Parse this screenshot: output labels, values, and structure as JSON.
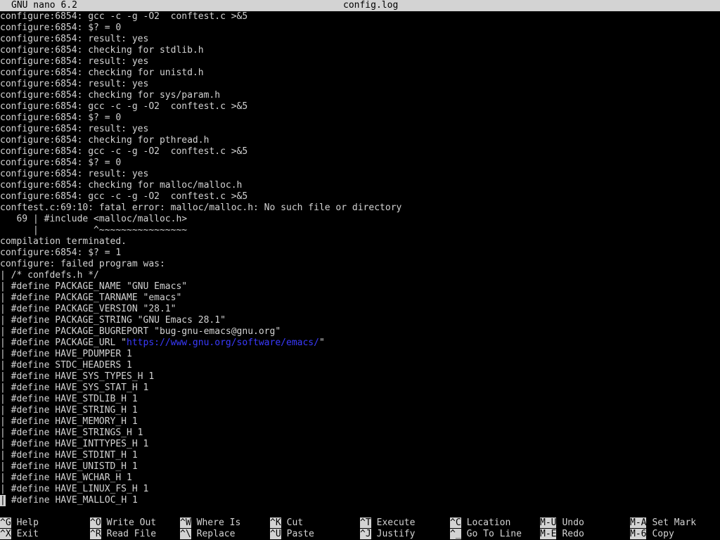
{
  "titlebar": {
    "app": "GNU nano 6.2",
    "filename": "config.log"
  },
  "editor": {
    "lines": [
      "configure:6854: gcc -c -g -O2  conftest.c >&5",
      "configure:6854: $? = 0",
      "configure:6854: result: yes",
      "configure:6854: checking for stdlib.h",
      "configure:6854: result: yes",
      "configure:6854: checking for unistd.h",
      "configure:6854: result: yes",
      "configure:6854: checking for sys/param.h",
      "configure:6854: gcc -c -g -O2  conftest.c >&5",
      "configure:6854: $? = 0",
      "configure:6854: result: yes",
      "configure:6854: checking for pthread.h",
      "configure:6854: gcc -c -g -O2  conftest.c >&5",
      "configure:6854: $? = 0",
      "configure:6854: result: yes",
      "configure:6854: checking for malloc/malloc.h",
      "configure:6854: gcc -c -g -O2  conftest.c >&5",
      "conftest.c:69:10: fatal error: malloc/malloc.h: No such file or directory",
      "   69 | #include <malloc/malloc.h>",
      "      |          ^~~~~~~~~~~~~~~~~",
      "compilation terminated.",
      "configure:6854: $? = 1",
      "configure: failed program was:",
      "| /* confdefs.h */",
      "| #define PACKAGE_NAME \"GNU Emacs\"",
      "| #define PACKAGE_TARNAME \"emacs\"",
      "| #define PACKAGE_VERSION \"28.1\"",
      "| #define PACKAGE_STRING \"GNU Emacs 28.1\"",
      "| #define PACKAGE_BUGREPORT \"bug-gnu-emacs@gnu.org\"",
      "| #define HAVE_PDUMPER 1",
      "| #define STDC_HEADERS 1",
      "| #define HAVE_SYS_TYPES_H 1",
      "| #define HAVE_SYS_STAT_H 1",
      "| #define HAVE_STDLIB_H 1",
      "| #define HAVE_STRING_H 1",
      "| #define HAVE_MEMORY_H 1",
      "| #define HAVE_STRINGS_H 1",
      "| #define HAVE_INTTYPES_H 1",
      "| #define HAVE_STDINT_H 1",
      "| #define HAVE_UNISTD_H 1",
      "| #define HAVE_WCHAR_H 1",
      "| #define HAVE_LINUX_FS_H 1",
      "| #define HAVE_MALLOC_H 1"
    ],
    "url_line": {
      "prefix": "| #define PACKAGE_URL \"",
      "url": "https://www.gnu.org/software/emacs/",
      "suffix": "\""
    },
    "last_line_rest": " #define HAVE_MALLOC_H 1",
    "cursor_char": "|"
  },
  "shortcuts": {
    "row0": [
      {
        "key": "^G",
        "label": "Help"
      },
      {
        "key": "^O",
        "label": "Write Out"
      },
      {
        "key": "^W",
        "label": "Where Is"
      },
      {
        "key": "^K",
        "label": "Cut"
      },
      {
        "key": "^T",
        "label": "Execute"
      },
      {
        "key": "^C",
        "label": "Location"
      },
      {
        "key": "M-U",
        "label": "Undo"
      },
      {
        "key": "M-A",
        "label": "Set Mark"
      }
    ],
    "row1": [
      {
        "key": "^X",
        "label": "Exit"
      },
      {
        "key": "^R",
        "label": "Read File"
      },
      {
        "key": "^\\",
        "label": "Replace"
      },
      {
        "key": "^U",
        "label": "Paste"
      },
      {
        "key": "^J",
        "label": "Justify"
      },
      {
        "key": "^_",
        "label": "Go To Line"
      },
      {
        "key": "M-E",
        "label": "Redo"
      },
      {
        "key": "M-6",
        "label": "Copy"
      }
    ]
  },
  "colors": {
    "background": "#000000",
    "text": "#d3d3d3",
    "bar": "#d3d3d3",
    "url": "#3a3aff"
  }
}
